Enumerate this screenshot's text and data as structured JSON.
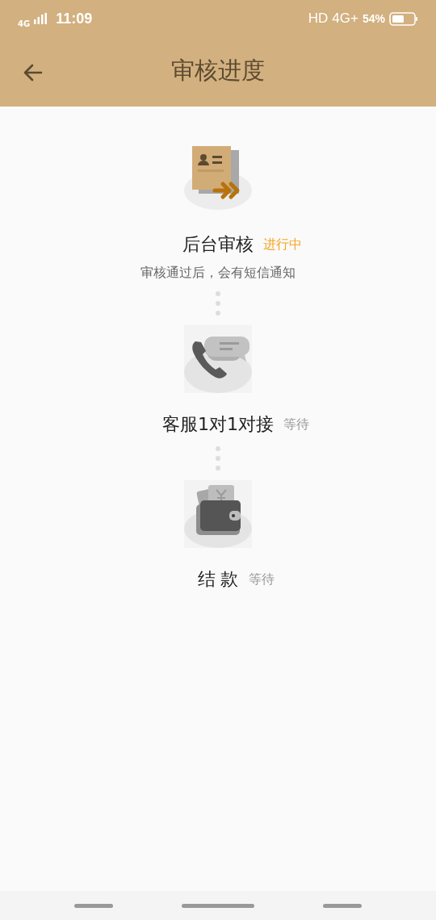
{
  "status_bar": {
    "network": "4G",
    "time": "11:09",
    "hd": "HD",
    "data": "4G+",
    "battery": "54%"
  },
  "header": {
    "title": "审核进度"
  },
  "steps": [
    {
      "kind": "review",
      "title": "后台审核",
      "status": "进行中",
      "active": true,
      "note": "审核通过后，会有短信通知"
    },
    {
      "kind": "phone",
      "title": "客服1对1对接",
      "status": "等待",
      "active": false
    },
    {
      "kind": "payment",
      "title": "结 款",
      "status": "等待",
      "active": false
    }
  ]
}
